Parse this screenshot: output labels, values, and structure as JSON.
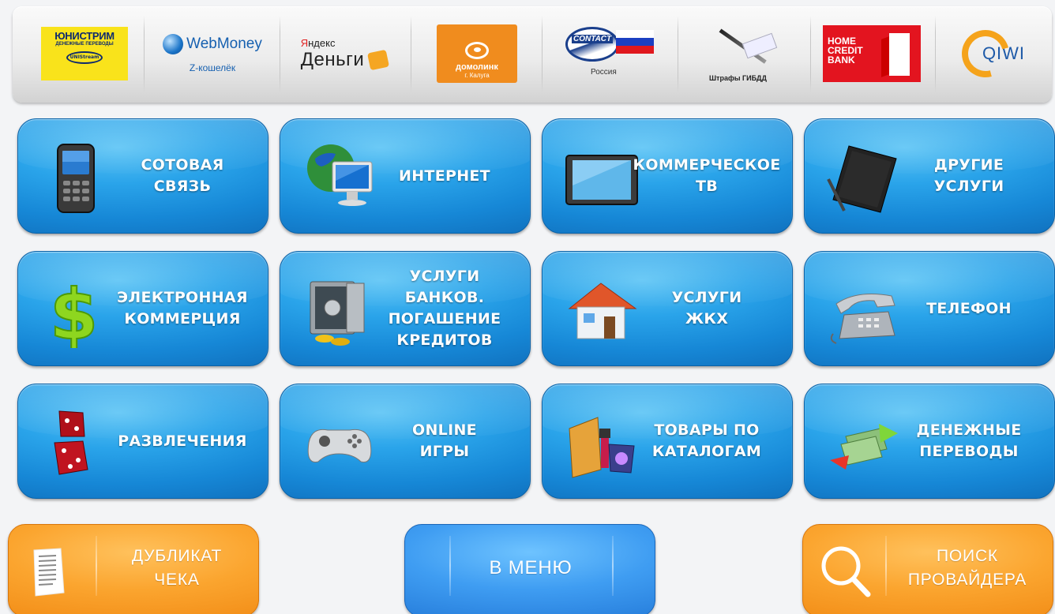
{
  "providers": {
    "unistream": {
      "line1": "ЮНИСТРИМ",
      "line2": "ДЕНЕЖНЫЕ ПЕРЕВОДЫ",
      "badge": "UNIStream"
    },
    "webmoney": {
      "name": "WebMoney",
      "sub": "Z-кошелёк"
    },
    "yandex": {
      "line1_y": "Я",
      "line1_rest": "ндекс",
      "line2": "Деньги"
    },
    "domolink": {
      "line1": "домолинк",
      "line2": "г. Калуга"
    },
    "contact": {
      "word": "CONTACT",
      "country": "Россия"
    },
    "gibdd": {
      "label": "Штрафы ГИБДД"
    },
    "homecredit": {
      "line1": "HOME",
      "line2": "CREDIT",
      "line3": "BANK"
    },
    "qiwi": {
      "name": "QIWI"
    }
  },
  "tiles": [
    {
      "label": "СОТОВАЯ\nСВЯЗЬ",
      "icon": "mobile-phone-icon"
    },
    {
      "label": "ИНТЕРНЕТ",
      "icon": "globe-monitor-icon"
    },
    {
      "label": "КОММЕРЧЕСКОЕ\nТВ",
      "icon": "tv-icon"
    },
    {
      "label": "ДРУГИЕ\nУСЛУГИ",
      "icon": "notebook-icon"
    },
    {
      "label": "ЭЛЕКТРОННАЯ\nКОММЕРЦИЯ",
      "icon": "dollar-icon"
    },
    {
      "label": "УСЛУГИ БАНКОВ.\nПОГАШЕНИЕ\nКРЕДИТОВ",
      "icon": "safe-icon"
    },
    {
      "label": "УСЛУГИ\nЖКХ",
      "icon": "house-icon"
    },
    {
      "label": "ТЕЛЕФОН",
      "icon": "telephone-icon"
    },
    {
      "label": "РАЗВЛЕЧЕНИЯ",
      "icon": "dice-icon"
    },
    {
      "label": "ONLINE\nИГРЫ",
      "icon": "gamepad-icon"
    },
    {
      "label": "ТОВАРЫ ПО\nКАТАЛОГАМ",
      "icon": "catalog-icon"
    },
    {
      "label": "ДЕНЕЖНЫЕ\nПЕРЕВОДЫ",
      "icon": "money-transfer-icon"
    }
  ],
  "bottom": {
    "receipt_label": "ДУБЛИКАТ\nЧЕКА",
    "menu_label": "В МЕНЮ",
    "search_label": "ПОИСК\nПРОВАЙДЕРА"
  },
  "colors": {
    "tile_blue": "#1a8ad8",
    "orange_button": "#f7981f",
    "blue_button": "#3a92ec"
  }
}
